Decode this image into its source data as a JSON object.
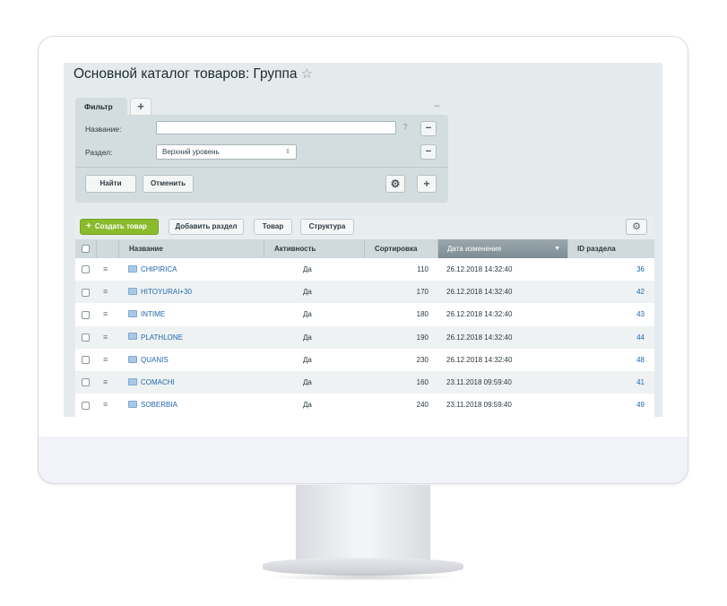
{
  "page": {
    "title": "Основной каталог товаров: Группа",
    "star_icon": "☆"
  },
  "filter": {
    "tab_label": "Фильтр",
    "add_tab_icon": "+",
    "collapse_icon": "–",
    "name_label": "Название:",
    "name_value": "",
    "help_icon": "?",
    "section_label": "Раздел:",
    "section_value": "Верхний уровень",
    "remove_icon": "−",
    "find_button": "Найти",
    "cancel_button": "Отменить",
    "add_icon": "+"
  },
  "toolbar": {
    "create_button": "Создать товар",
    "create_icon": "+",
    "add_section_button": "Добавить раздел",
    "product_button": "Товар",
    "structure_button": "Структура"
  },
  "table": {
    "columns": [
      "Название",
      "Активность",
      "Сортировка",
      "Дата изменения",
      "ID раздела"
    ],
    "sort_icon": "▼",
    "row_menu_icon": "≡",
    "rows": [
      {
        "name": "CHIPIRICA",
        "active": "Да",
        "sort": "110",
        "date": "26.12.2018 14:32:40",
        "id": "36"
      },
      {
        "name": "HITOYURAI+30",
        "active": "Да",
        "sort": "170",
        "date": "26.12.2018 14:32:40",
        "id": "42"
      },
      {
        "name": "INTIME",
        "active": "Да",
        "sort": "180",
        "date": "26.12.2018 14:32:40",
        "id": "43"
      },
      {
        "name": "PLATHLONE",
        "active": "Да",
        "sort": "190",
        "date": "26.12.2018 14:32:40",
        "id": "44"
      },
      {
        "name": "QUANIS",
        "active": "Да",
        "sort": "230",
        "date": "26.12.2018 14:32:40",
        "id": "48"
      },
      {
        "name": "COMACHI",
        "active": "Да",
        "sort": "160",
        "date": "23.11.2018 09:59:40",
        "id": "41"
      },
      {
        "name": "SOBERBIA",
        "active": "Да",
        "sort": "240",
        "date": "23.11.2018 09:59:40",
        "id": "49"
      }
    ]
  },
  "colors": {
    "accent_green": "#8abb2d",
    "link_blue": "#2067b0",
    "header_gray": "#d0d9db"
  }
}
